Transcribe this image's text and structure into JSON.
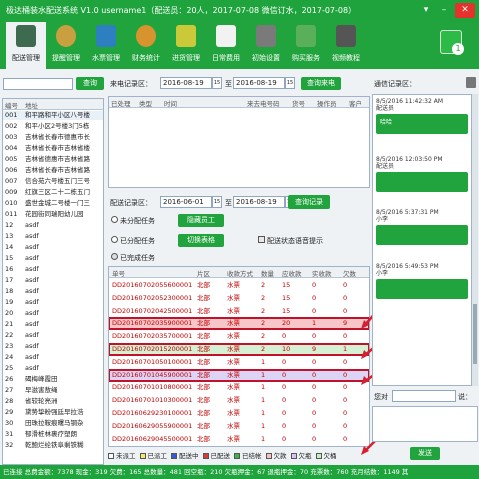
{
  "titlebar": {
    "text": "极达桶装水配送系统 V1.0      username1（配送员：20人，2017-07-08   微信订水，2017-07-08）"
  },
  "toolbar": {
    "items": [
      {
        "label": "配送管理",
        "icon": "delivery-icon",
        "color": "#3e6b4f"
      },
      {
        "label": "提醒管理",
        "icon": "reminder-icon",
        "color": "#c8a040"
      },
      {
        "label": "水票管理",
        "icon": "ticket-icon",
        "color": "#2e7fc0"
      },
      {
        "label": "财务统计",
        "icon": "finance-icon",
        "color": "#d6932e"
      },
      {
        "label": "进货管理",
        "icon": "purchase-icon",
        "color": "#c9c93a"
      },
      {
        "label": "日常费用",
        "icon": "expense-icon",
        "color": "#f2f2f2"
      },
      {
        "label": "初始设置",
        "icon": "settings-icon",
        "color": "#7a7a7a"
      },
      {
        "label": "购买服务",
        "icon": "buy-service-icon",
        "color": "#5ab05a"
      },
      {
        "label": "视频教程",
        "icon": "video-icon",
        "color": "#555555"
      }
    ]
  },
  "left": {
    "query_button": "查询",
    "col_id": "编号",
    "col_addr": "地址",
    "rows": [
      {
        "id": "001",
        "addr": "和平路和平小区八号楼"
      },
      {
        "id": "002",
        "addr": "和平小区2号楼3门5栋"
      },
      {
        "id": "003",
        "addr": "吉林省长春市德惠市长"
      },
      {
        "id": "004",
        "addr": "吉林省长春市吉林省楼"
      },
      {
        "id": "005",
        "addr": "吉林省德惠市吉林省路"
      },
      {
        "id": "006",
        "addr": "吉林省长春市吉林省路"
      },
      {
        "id": "007",
        "addr": "信合苑六号楼五门三号"
      },
      {
        "id": "009",
        "addr": "红旗三区二十二栋五门"
      },
      {
        "id": "010",
        "addr": "盛世金城二号楼一门三"
      },
      {
        "id": "011",
        "addr": "花园街同瑞阳幼儿园"
      },
      {
        "id": "12",
        "addr": "asdf"
      },
      {
        "id": "13",
        "addr": "asdf"
      },
      {
        "id": "14",
        "addr": "asdf"
      },
      {
        "id": "15",
        "addr": "asdf"
      },
      {
        "id": "16",
        "addr": "asdf"
      },
      {
        "id": "17",
        "addr": "asdf"
      },
      {
        "id": "18",
        "addr": "asdf"
      },
      {
        "id": "19",
        "addr": "asdf"
      },
      {
        "id": "20",
        "addr": "asdf"
      },
      {
        "id": "21",
        "addr": "asdf"
      },
      {
        "id": "22",
        "addr": "asdf"
      },
      {
        "id": "23",
        "addr": "asdf"
      },
      {
        "id": "24",
        "addr": "asdf"
      },
      {
        "id": "25",
        "addr": "asdf"
      },
      {
        "id": "26",
        "addr": "碣梅峰霞田"
      },
      {
        "id": "27",
        "addr": "早滋害敖绳"
      },
      {
        "id": "28",
        "addr": "省较轮亮洲"
      },
      {
        "id": "29",
        "addr": "黛势挚粉强廷早拉浩"
      },
      {
        "id": "30",
        "addr": "田珠拉鞍痕曙马钢杂"
      },
      {
        "id": "31",
        "addr": "郁滑桩林裹疗塑朗"
      },
      {
        "id": "32",
        "addr": "乾鲍烂纶铁阜剩铁糊"
      }
    ]
  },
  "calls": {
    "label": "来电记录区：",
    "date_from": "2016-08-19",
    "date_to": "2016-08-19",
    "button": "查询来电",
    "cols": [
      "已处理",
      "类型",
      "时间",
      "来去电号码",
      "货号",
      "操作员",
      "客户"
    ]
  },
  "delivery": {
    "label": "配送记录区：",
    "date_from": "2016-06-01",
    "date_to": "2016-08-19",
    "button": "查询记录",
    "unassigned": "未分配任务",
    "assigned": "已分配任务",
    "completed": "已完成任务",
    "hide_staff": "隐藏员工",
    "switch_view": "切换表格",
    "voice": "配送状态语音提示",
    "cols": [
      "单号",
      "片区",
      "收款方式",
      "数量",
      "应收款",
      "实收款",
      "欠数"
    ],
    "rows": [
      {
        "no": "DD20160702055600001",
        "area": "北部",
        "pay": "水票",
        "qty": "2",
        "due": "15",
        "paid": "0",
        "owe": "0",
        "hl": ""
      },
      {
        "no": "DD20160702052300001",
        "area": "北部",
        "pay": "水票",
        "qty": "2",
        "due": "15",
        "paid": "0",
        "owe": "0",
        "hl": ""
      },
      {
        "no": "DD20160702042500001",
        "area": "北部",
        "pay": "水票",
        "qty": "2",
        "due": "15",
        "paid": "0",
        "owe": "0",
        "hl": ""
      },
      {
        "no": "DD20160702035900001",
        "area": "北部",
        "pay": "水票",
        "qty": "2",
        "due": "20",
        "paid": "1",
        "owe": "9",
        "hl": "red"
      },
      {
        "no": "DD20160702035700001",
        "area": "北部",
        "pay": "水票",
        "qty": "2",
        "due": "0",
        "paid": "0",
        "owe": "0",
        "hl": ""
      },
      {
        "no": "DD20160702015200001",
        "area": "北部",
        "pay": "水票",
        "qty": "2",
        "due": "10",
        "paid": "9",
        "owe": "1",
        "hl": "green"
      },
      {
        "no": "DD20160701050100001",
        "area": "北部",
        "pay": "水票",
        "qty": "1",
        "due": "0",
        "paid": "0",
        "owe": "0",
        "hl": ""
      },
      {
        "no": "DD20160701045900001",
        "area": "北部",
        "pay": "水票",
        "qty": "1",
        "due": "0",
        "paid": "0",
        "owe": "0",
        "hl": "purple"
      },
      {
        "no": "DD20160701010800001",
        "area": "北部",
        "pay": "水票",
        "qty": "1",
        "due": "0",
        "paid": "0",
        "owe": "0",
        "hl": ""
      },
      {
        "no": "DD20160701010300001",
        "area": "北部",
        "pay": "水票",
        "qty": "1",
        "due": "0",
        "paid": "0",
        "owe": "0",
        "hl": ""
      },
      {
        "no": "DD20160629230100001",
        "area": "北部",
        "pay": "水票",
        "qty": "1",
        "due": "0",
        "paid": "0",
        "owe": "0",
        "hl": ""
      },
      {
        "no": "DD20160629055900001",
        "area": "北部",
        "pay": "水票",
        "qty": "1",
        "due": "0",
        "paid": "0",
        "owe": "0",
        "hl": ""
      },
      {
        "no": "DD20160629045500001",
        "area": "北部",
        "pay": "水票",
        "qty": "1",
        "due": "0",
        "paid": "0",
        "owe": "0",
        "hl": ""
      }
    ],
    "legend": [
      {
        "label": "未派工",
        "color": "#ffffff"
      },
      {
        "label": "已派工",
        "color": "#f5e96a"
      },
      {
        "label": "配送中",
        "color": "#3b5bd6"
      },
      {
        "label": "已配送",
        "color": "#d93a3a"
      },
      {
        "label": "已结帐",
        "color": "#3bb54a"
      },
      {
        "label": "欠款",
        "color": "#f3c2c2"
      },
      {
        "label": "欠瓶",
        "color": "#d8c6f0"
      },
      {
        "label": "欠桶",
        "color": "#c8ecc8"
      }
    ]
  },
  "chat": {
    "title": "通信记录区：",
    "messages": [
      {
        "time": "8/5/2016 11:42:32 AM",
        "who": "配送员",
        "text": "哈哈",
        "side": "left"
      },
      {
        "time": "8/5/2016 12:03:50 PM",
        "who": "配送员",
        "text": "",
        "side": "left"
      },
      {
        "time": "8/5/2016 5:37:31 PM",
        "who": "小李",
        "text": "",
        "side": "right"
      },
      {
        "time": "8/5/2016 5:49:53 PM",
        "who": "小李",
        "text": "",
        "side": "right"
      }
    ],
    "you_label": "您对",
    "input_suffix": "说：",
    "send": "发送"
  },
  "status": {
    "text": "已连接  总费金额：7378  现金：319  欠费：165  总数量：481  回空瓶：210  欠瓶押金：67  退瓶押金：70  充票数：760  充月结数：1149 其"
  }
}
